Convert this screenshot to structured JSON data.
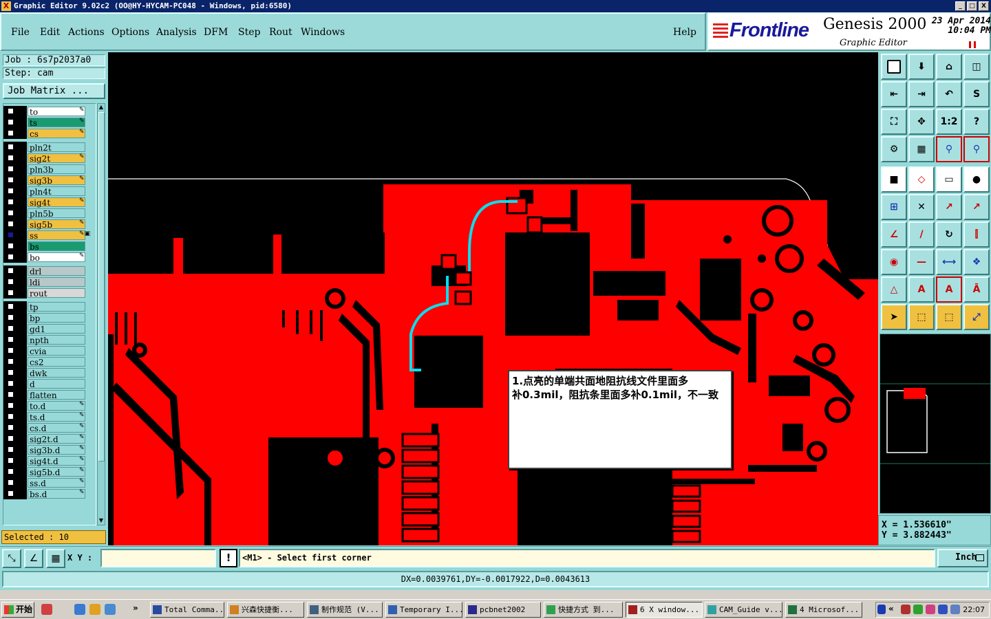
{
  "window": {
    "title": "Graphic Editor 9.02c2  (OO@HY-HYCAM-PC048 - Windows, pid:6580)",
    "buttons": [
      "_",
      "□",
      "X"
    ]
  },
  "menu": {
    "items": [
      "File",
      "Edit",
      "Actions",
      "Options",
      "Analysis",
      "DFM",
      "Step",
      "Rout",
      "Windows"
    ],
    "help": "Help"
  },
  "brand": {
    "logo": "Frontline",
    "product": "Genesis 2000",
    "subtitle": "Graphic Editor",
    "date": "23 Apr 2014",
    "time": "10:04 PM"
  },
  "job": {
    "job_label": "Job : 6s7p2037a0",
    "step_label": "Step: cam",
    "matrix_button": "Job Matrix ..."
  },
  "layers": [
    {
      "name": "to",
      "color": "#ffffff",
      "flag": "✎",
      "box": "#ffffff"
    },
    {
      "name": "ts",
      "color": "#1a9a70",
      "flag": "✎",
      "box": "#ffffff"
    },
    {
      "name": "cs",
      "color": "#f0c040",
      "flag": "✎",
      "box": "#ffffff"
    },
    {
      "name": "pln2t",
      "color": "#97d8d8",
      "flag": "",
      "box": "#ffffff"
    },
    {
      "name": "sig2t",
      "color": "#f0c040",
      "flag": "✎",
      "box": "#ffffff"
    },
    {
      "name": "pln3b",
      "color": "#97d8d8",
      "flag": "",
      "box": "#ffffff"
    },
    {
      "name": "sig3b",
      "color": "#f0c040",
      "flag": "✎",
      "box": "#ffffff"
    },
    {
      "name": "pln4t",
      "color": "#97d8d8",
      "flag": "",
      "box": "#ffffff"
    },
    {
      "name": "sig4t",
      "color": "#f0c040",
      "flag": "✎",
      "box": "#ffffff"
    },
    {
      "name": "pln5b",
      "color": "#97d8d8",
      "flag": "",
      "box": "#ffffff"
    },
    {
      "name": "sig5b",
      "color": "#f0c040",
      "flag": "✎",
      "box": "#ffffff"
    },
    {
      "name": "ss",
      "color": "#f0c040",
      "flag": "✎▣",
      "box": "#1a1a9a"
    },
    {
      "name": "bs",
      "color": "#1a9a70",
      "flag": "",
      "box": "#ffffff"
    },
    {
      "name": "bo",
      "color": "#ffffff",
      "flag": "✎",
      "box": "#ffffff"
    },
    {
      "name": "drl",
      "color": "#b8c8c8",
      "flag": "",
      "box": "#ffffff"
    },
    {
      "name": "ldi",
      "color": "#b8c8c8",
      "flag": "",
      "box": "#ffffff"
    },
    {
      "name": "rout",
      "color": "#d8d8d8",
      "flag": "",
      "box": "#ffffff"
    },
    {
      "name": "tp",
      "color": "#97d8d8",
      "flag": "",
      "box": "#ffffff"
    },
    {
      "name": "bp",
      "color": "#97d8d8",
      "flag": "",
      "box": "#ffffff"
    },
    {
      "name": "gd1",
      "color": "#97d8d8",
      "flag": "",
      "box": "#ffffff"
    },
    {
      "name": "npth",
      "color": "#97d8d8",
      "flag": "",
      "box": "#ffffff"
    },
    {
      "name": "cvia",
      "color": "#97d8d8",
      "flag": "",
      "box": "#ffffff"
    },
    {
      "name": "cs2",
      "color": "#97d8d8",
      "flag": "",
      "box": "#ffffff"
    },
    {
      "name": "dwk",
      "color": "#97d8d8",
      "flag": "",
      "box": "#ffffff"
    },
    {
      "name": "d",
      "color": "#97d8d8",
      "flag": "",
      "box": "#ffffff"
    },
    {
      "name": "flatten",
      "color": "#97d8d8",
      "flag": "",
      "box": "#ffffff"
    },
    {
      "name": "to.d",
      "color": "#97d8d8",
      "flag": "✎",
      "box": "#ffffff"
    },
    {
      "name": "ts.d",
      "color": "#97d8d8",
      "flag": "✎",
      "box": "#ffffff"
    },
    {
      "name": "cs.d",
      "color": "#97d8d8",
      "flag": "✎",
      "box": "#ffffff"
    },
    {
      "name": "sig2t.d",
      "color": "#97d8d8",
      "flag": "✎",
      "box": "#ffffff"
    },
    {
      "name": "sig3b.d",
      "color": "#97d8d8",
      "flag": "✎",
      "box": "#ffffff"
    },
    {
      "name": "sig4t.d",
      "color": "#97d8d8",
      "flag": "✎",
      "box": "#ffffff"
    },
    {
      "name": "sig5b.d",
      "color": "#97d8d8",
      "flag": "✎",
      "box": "#ffffff"
    },
    {
      "name": "ss.d",
      "color": "#97d8d8",
      "flag": "✎",
      "box": "#ffffff"
    },
    {
      "name": "bs.d",
      "color": "#97d8d8",
      "flag": "✎",
      "box": "#ffffff"
    }
  ],
  "selected": "Selected : 10",
  "note": {
    "line1": "1.点亮的单端共面地阻抗线文件里面多",
    "line2": "补0.3mil，阻抗条里面多补0.1mil，不一致"
  },
  "coords": {
    "x": "X = 1.536610\"",
    "y": "Y = 3.882443\""
  },
  "command": {
    "xy_label": "X Y :",
    "xy_value": "",
    "alert": "!",
    "prompt": "<M1> - Select first corner",
    "unit": "Inch"
  },
  "measure": "DX=0.0039761,DY=-0.0017922,D=0.0043613",
  "taskbar": {
    "start": "开始",
    "tasks": [
      {
        "label": "Total Comma...",
        "icon": "#2a4aa0"
      },
      {
        "label": "兴森快捷衡...",
        "icon": "#d08020"
      },
      {
        "label": "制作规范 (V...",
        "icon": "#406080"
      },
      {
        "label": "Temporary I...",
        "icon": "#3060b0"
      },
      {
        "label": "pcbnet2002",
        "icon": "#2a2a8a"
      },
      {
        "label": "快捷方式 到...",
        "icon": "#30a050"
      },
      {
        "label": "6 X window...",
        "icon": "#a02020"
      },
      {
        "label": "CAM_Guide v...",
        "icon": "#30a0a0"
      },
      {
        "label": "4 Microsof...",
        "icon": "#207040"
      }
    ],
    "clock": "22:07",
    "chevron": "»"
  },
  "tools": {
    "ratio_label": "1:2",
    "help_label": "?"
  },
  "colors": {
    "canvas_bg": "#000000",
    "copper": "#ff0000",
    "highlight": "#00e0f0",
    "panel": "#97d8d8",
    "selected_bg": "#f0c040"
  }
}
